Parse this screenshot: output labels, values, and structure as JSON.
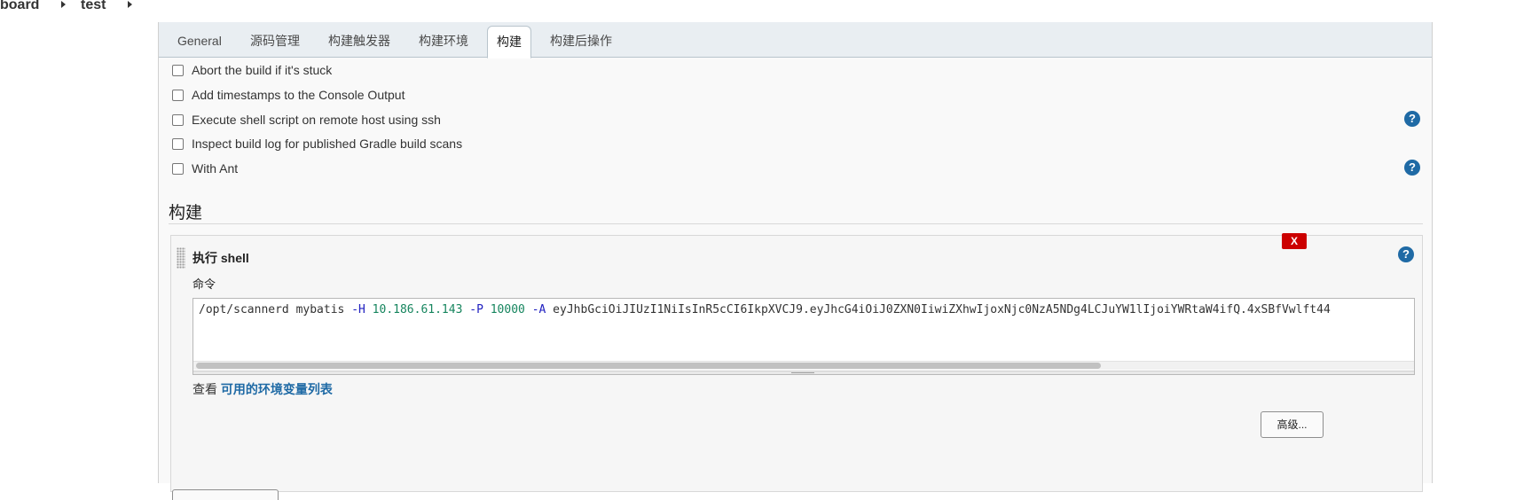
{
  "breadcrumb": {
    "item1": "board",
    "item2": "test"
  },
  "tabs": [
    {
      "label": "General"
    },
    {
      "label": "源码管理"
    },
    {
      "label": "构建触发器"
    },
    {
      "label": "构建环境"
    },
    {
      "label": "构建"
    },
    {
      "label": "构建后操作"
    }
  ],
  "active_tab": "构建",
  "options": [
    {
      "label": "Abort the build if it's stuck",
      "checked": false
    },
    {
      "label": "Add timestamps to the Console Output",
      "checked": false
    },
    {
      "label": "Execute shell script on remote host using ssh",
      "checked": false
    },
    {
      "label": "Inspect build log for published Gradle build scans",
      "checked": false
    },
    {
      "label": "With Ant",
      "checked": false
    }
  ],
  "build": {
    "section_title": "构建",
    "step_title": "执行 shell",
    "delete_label": "X",
    "command_label": "命令",
    "command": {
      "p1": "/opt/scannerd mybatis ",
      "f1": "-H",
      "ip": " 10.186.61.143 ",
      "f2": "-P",
      "port": " 10000 ",
      "f3": "-A",
      "token": " eyJhbGciOiJIUzI1NiIsInR5cCI6IkpXVCJ9.eyJhcG4iOiJ0ZXN0IiwiZXhwIjoxNjc0NzA5NDg4LCJuYW1lIjoiYWRtaW4ifQ.4xSBfVwlft44"
    },
    "env_prefix": "查看",
    "env_link": "可用的环境变量列表",
    "advanced_label": "高级..."
  },
  "help_icon": "?",
  "colors": {
    "accent": "#1f6aa5",
    "danger": "#cc0000"
  }
}
